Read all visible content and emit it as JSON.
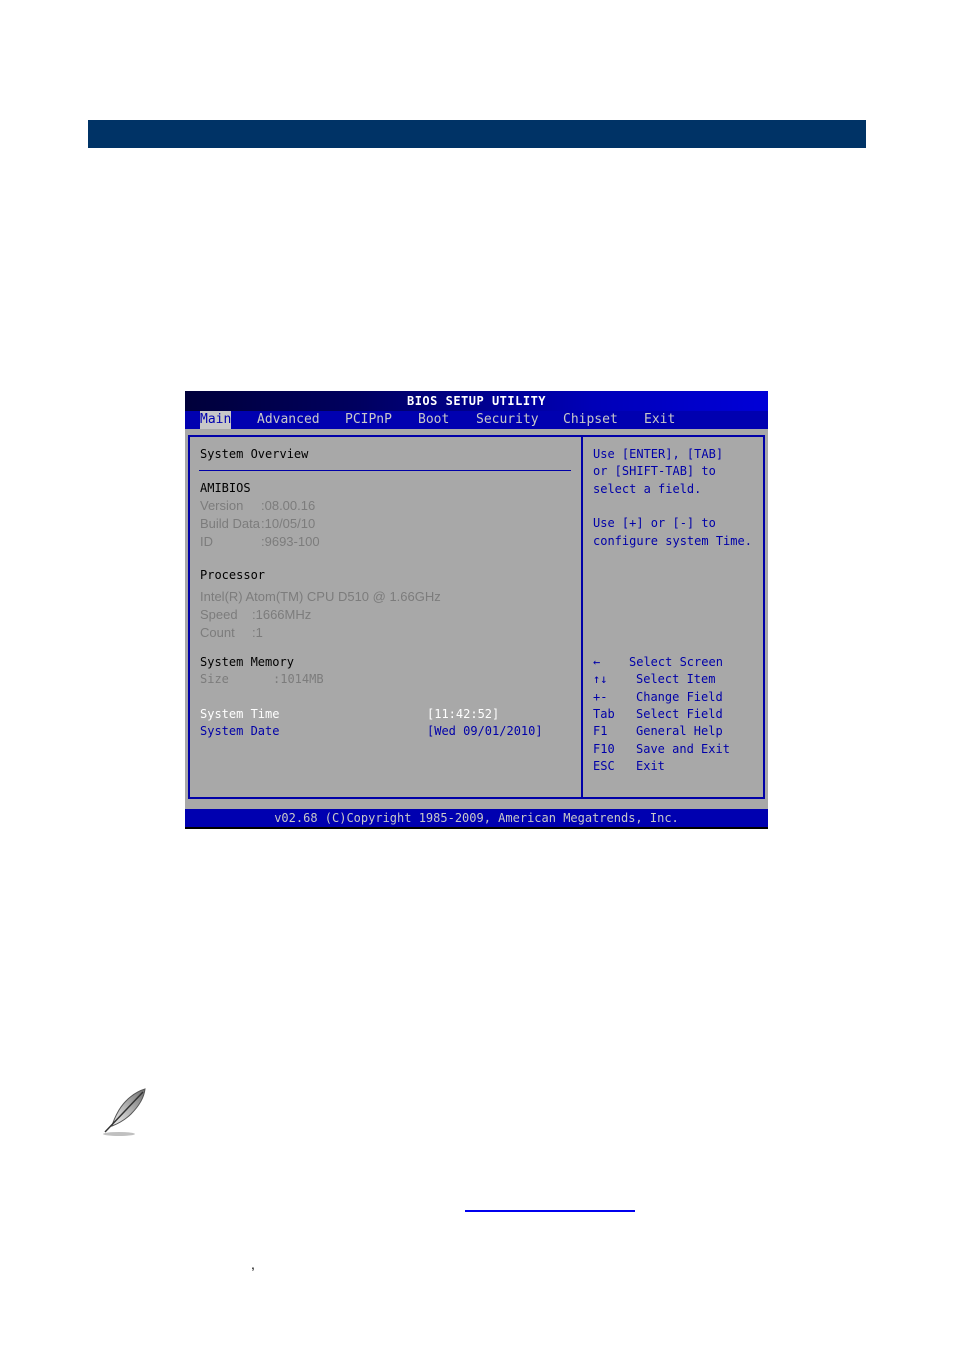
{
  "document": {
    "section_bar_color": "#003366",
    "link_color": "#0000ee",
    "stray_punctuation": ","
  },
  "bios": {
    "title": "BIOS SETUP UTILITY",
    "menu": [
      {
        "label": "Main",
        "active": true
      },
      {
        "label": "Advanced",
        "active": false
      },
      {
        "label": "PCIPnP",
        "active": false
      },
      {
        "label": "Boot",
        "active": false
      },
      {
        "label": "Security",
        "active": false
      },
      {
        "label": "Chipset",
        "active": false
      },
      {
        "label": "Exit",
        "active": false
      }
    ],
    "main": {
      "heading": "System Overview",
      "amibios": {
        "heading": "AMIBIOS",
        "rows": [
          {
            "label": "Version",
            "value": ":08.00.16"
          },
          {
            "label": "Build Data",
            "value": ":10/05/10"
          },
          {
            "label": "ID",
            "value": ":9693-100"
          }
        ]
      },
      "processor": {
        "heading": "Processor",
        "name": "Intel(R) Atom(TM) CPU D510 @ 1.66GHz",
        "rows": [
          {
            "label": "Speed",
            "value": ":1666MHz"
          },
          {
            "label": "Count",
            "value": ":1"
          }
        ]
      },
      "memory": {
        "heading": "System Memory",
        "rows": [
          {
            "label": "Size",
            "value": ":1014MB"
          }
        ]
      },
      "settings": [
        {
          "label": "System Time",
          "value": "[11:42:52]",
          "selected": true
        },
        {
          "label": "System Date",
          "value": "[Wed 09/01/2010]",
          "selected": false
        }
      ]
    },
    "help": {
      "lines": [
        "Use [ENTER], [TAB]",
        "or [SHIFT-TAB] to",
        "select a field.",
        "",
        "Use [+] or [-] to",
        "configure system Time."
      ],
      "keys": [
        {
          "key": "←",
          "action": "Select Screen"
        },
        {
          "key": "↑↓",
          "action": "Select Item"
        },
        {
          "key": "+-",
          "action": "Change Field"
        },
        {
          "key": "Tab",
          "action": "Select Field"
        },
        {
          "key": "F1",
          "action": "General Help"
        },
        {
          "key": "F10",
          "action": "Save and Exit"
        },
        {
          "key": "ESC",
          "action": "Exit"
        }
      ]
    },
    "footer": "v02.68 (C)Copyright 1985-2009, American Megatrends, Inc.",
    "colors": {
      "background": "#a8a8a8",
      "menubar": "#0000b0",
      "text_blue": "#0000a8",
      "text_gray": "#7c7c7c"
    }
  }
}
